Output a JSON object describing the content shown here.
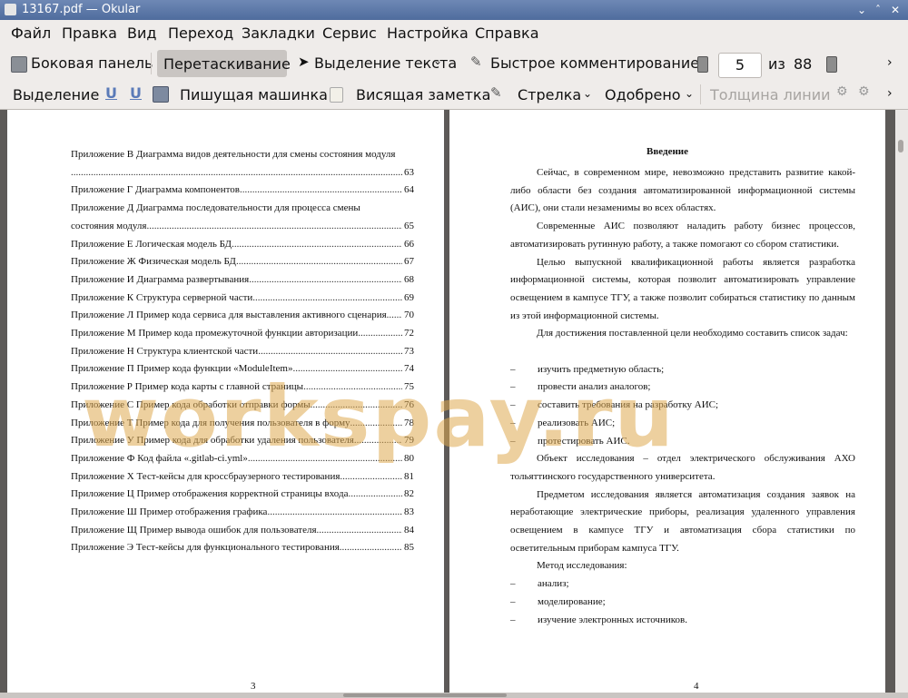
{
  "window": {
    "title": "13167.pdf  — Okular"
  },
  "menu": [
    "Файл",
    "Правка",
    "Вид",
    "Переход",
    "Закладки",
    "Сервис",
    "Настройка",
    "Справка"
  ],
  "toolbar": {
    "sidebar": "Боковая панель",
    "drag": "Перетаскивание",
    "text_select": "Выделение текста",
    "quick_comment": "Быстрое комментирование",
    "page_current": "5",
    "page_of": "из",
    "page_total": "88"
  },
  "annot_toolbar": {
    "selection": "Выделение",
    "typewriter": "Пишущая машинка",
    "sticky_note": "Висящая заметка",
    "arrow": "Стрелка",
    "approved": "Одобрено",
    "line_width": "Толщина линии"
  },
  "page_left": {
    "toc": [
      {
        "title": "Приложение В Диаграмма видов деятельности для смены состояния модуля",
        "title2": "",
        "page": "63"
      },
      {
        "title": "Приложение Г Диаграмма компонентов",
        "page": "64"
      },
      {
        "title": "Приложение Д Диаграмма последовательности для процесса смены",
        "title2": "состояния модуля",
        "page": "65"
      },
      {
        "title": "Приложение Е Логическая модель БД",
        "page": "66"
      },
      {
        "title": "Приложение Ж Физическая модель БД",
        "page": "67"
      },
      {
        "title": "Приложение И Диаграмма развертывания",
        "page": "68"
      },
      {
        "title": "Приложение К Структура серверной части",
        "page": "69"
      },
      {
        "title": "Приложение Л Пример кода сервиса для выставления активного сценария",
        "page": "70"
      },
      {
        "title": "Приложение М Пример кода промежуточной функции авторизации",
        "page": "72"
      },
      {
        "title": "Приложение Н Структура клиентской части",
        "page": "73"
      },
      {
        "title": "Приложение П Пример кода функции «ModuleItem»",
        "page": "74"
      },
      {
        "title": "Приложение Р Пример кода карты с главной страницы",
        "page": "75"
      },
      {
        "title": "Приложение С Пример кода обработки отправки формы",
        "page": "76"
      },
      {
        "title": "Приложение Т Пример кода для получения пользователя в форму",
        "page": "78"
      },
      {
        "title": "Приложение У Пример кода для обработки удаления пользователя",
        "page": "79"
      },
      {
        "title": "Приложение Ф Код файла «.gitlab-ci.yml»",
        "page": "80"
      },
      {
        "title": "Приложение Х Тест-кейсы для кроссбраузерного тестирования",
        "page": "81"
      },
      {
        "title": "Приложение Ц Пример отображения корректной страницы входа",
        "page": "82"
      },
      {
        "title": "Приложение Ш Пример отображения графика",
        "page": "83"
      },
      {
        "title": "Приложение Щ Пример вывода ошибок для пользователя",
        "page": "84"
      },
      {
        "title": "Приложение Э Тест-кейсы для функционального тестирования",
        "page": "85"
      }
    ],
    "page_number": "3"
  },
  "page_right": {
    "heading": "Введение",
    "paragraphs": [
      "Сейчас, в современном мире, невозможно представить развитие какой-либо области без создания автоматизированной информационной системы (АИС), они стали незаменимы во всех областях.",
      "Современные АИС позволяют наладить работу бизнес процессов, автоматизировать рутинную работу, а также помогают со сбором статистики.",
      "Целью выпускной квалификационной работы является разработка информационной системы, которая позволит автоматизировать управление освещением в кампусе ТГУ, а также позволит собираться статистику по данным из этой информационной системы.",
      "Для достижения поставленной цели необходимо составить список задач:"
    ],
    "tasks": [
      "изучить предметную область;",
      "провести анализ аналогов;",
      "составить требования на разработку АИС;",
      "реализовать АИС;",
      "протестировать АИС."
    ],
    "object": "Объект исследования – отдел электрического обслуживания АХО тольяттинского государственного университета.",
    "subject": "Предметом исследования является автоматизация создания заявок на неработающие электрические приборы, реализация удаленного управления освещением в кампусе ТГУ и автоматизация сбора статистики по осветительным приборам кампуса ТГУ.",
    "method_title": "Метод исследования:",
    "methods": [
      "анализ;",
      "моделирование;",
      "изучение электронных источников."
    ],
    "page_number": "4"
  },
  "watermark": "workspay.ru"
}
